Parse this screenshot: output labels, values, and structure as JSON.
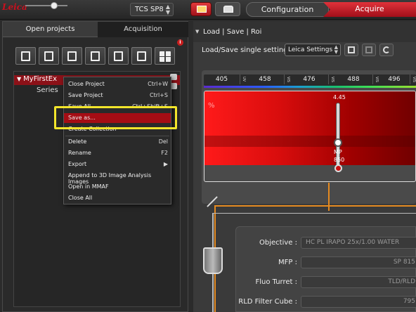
{
  "topbar": {
    "logo_text": "Leica",
    "system_select": "TCS SP8",
    "steps": [
      "Configuration",
      "Acquire"
    ]
  },
  "left": {
    "tabs": [
      "Open projects",
      "Acquisition"
    ],
    "info_badge": "i",
    "toolbar_icons": [
      "export-icon",
      "new-project-icon",
      "open-folder-icon",
      "save-icon",
      "edit-icon",
      "search-document-icon",
      "grid-icon"
    ],
    "tree": {
      "project": "MyFirstEx",
      "series": "Series"
    },
    "context_menu": [
      {
        "label": "Close Project",
        "shortcut": "Ctrl+W"
      },
      {
        "label": "Save Project",
        "shortcut": "Ctrl+S"
      },
      {
        "label": "Save All",
        "shortcut": "Ctrl+Shift+S"
      },
      {
        "label": "Save as...",
        "shortcut": ""
      },
      {
        "label": "Create Collection",
        "shortcut": ""
      },
      {
        "label": "Delete",
        "shortcut": "Del"
      },
      {
        "label": "Rename",
        "shortcut": "F2"
      },
      {
        "label": "Export",
        "shortcut": "▶"
      },
      {
        "label": "Append to 3D Image Analysis Images",
        "shortcut": ""
      },
      {
        "label": "Open in MMAF",
        "shortcut": ""
      },
      {
        "label": "Close All",
        "shortcut": ""
      }
    ]
  },
  "right": {
    "section_title": "Load | Save | Roi",
    "load_label": "Load/Save single setting :",
    "load_select": "Leica Settings",
    "wavelengths": [
      {
        "nm": "405",
        "tag": "UV"
      },
      {
        "nm": "458",
        "tag": "VIS"
      },
      {
        "nm": "476",
        "tag": "VIS"
      },
      {
        "nm": "488",
        "tag": "VIS"
      },
      {
        "nm": "496",
        "tag": "VIS"
      }
    ],
    "percent_symbol": "%",
    "laser": {
      "value": "4.45",
      "label": "MP",
      "wavelength": "850"
    },
    "optics": [
      {
        "label": "Objective :",
        "value": "HC PL IRAPO    25x/1.00 WATER"
      },
      {
        "label": "MFP :",
        "value": "SP 815"
      },
      {
        "label": "Fluo Turret :",
        "value": "TLD/RLD"
      },
      {
        "label": "RLD Filter Cube :",
        "value": "795"
      }
    ]
  }
}
